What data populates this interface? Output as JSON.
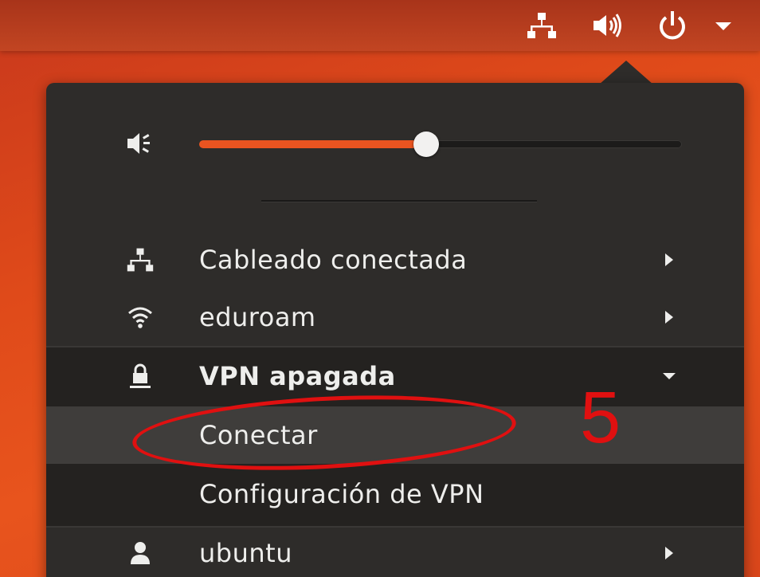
{
  "topbar": {
    "icons": [
      "network-wired-icon",
      "volume-high-icon",
      "power-icon",
      "chevron-down-icon"
    ]
  },
  "volume": {
    "icon": "volume-medium-icon",
    "level_percent": 47
  },
  "menu": {
    "wired": {
      "label": "Cableado conectada",
      "icon": "network-wired-icon"
    },
    "wifi": {
      "label": "eduroam",
      "icon": "wifi-icon"
    },
    "vpn": {
      "label": "VPN apagada",
      "icon": "vpn-lock-icon"
    },
    "vpn_connect": {
      "label": "Conectar"
    },
    "vpn_settings": {
      "label": "Configuración de VPN"
    },
    "user": {
      "label": "ubuntu",
      "icon": "user-icon"
    }
  },
  "annotation": {
    "number": "5",
    "color": "#e01010"
  },
  "colors": {
    "accent": "#e95420",
    "menu_bg": "#2e2c2a",
    "text": "#eeeeec"
  }
}
